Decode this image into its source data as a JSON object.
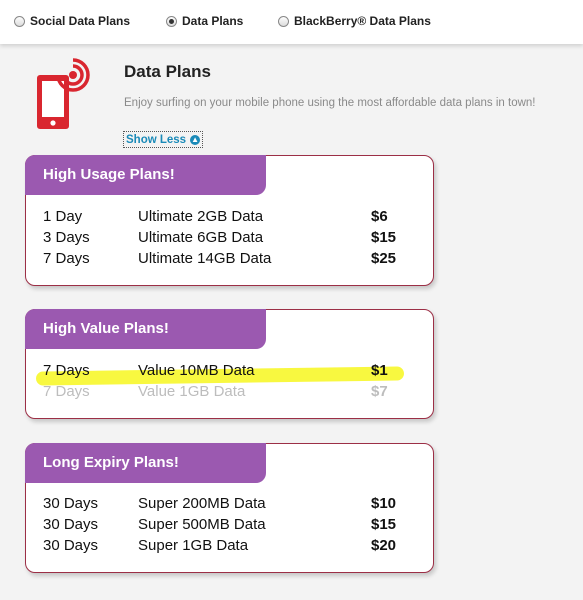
{
  "tabs": [
    {
      "label": "Social Data Plans",
      "checked": false
    },
    {
      "label": "Data Plans",
      "checked": true
    },
    {
      "label": "BlackBerry® Data Plans",
      "checked": false
    }
  ],
  "header": {
    "title": "Data Plans",
    "subtitle": "Enjoy surfing on your mobile phone using the most affordable data plans in town!",
    "show_less": "Show Less"
  },
  "icon_color": "#d9262f",
  "accent_purple": "#9b59b0",
  "cards": [
    {
      "title": "High Usage Plans!",
      "rows": [
        {
          "duration": "1 Day",
          "plan": "Ultimate 2GB Data",
          "price": "$6"
        },
        {
          "duration": "3 Days",
          "plan": "Ultimate 6GB Data",
          "price": "$15"
        },
        {
          "duration": "7 Days",
          "plan": "Ultimate 14GB Data",
          "price": "$25"
        }
      ]
    },
    {
      "title": "High Value Plans!",
      "rows": [
        {
          "duration": "7 Days",
          "plan": "Value 10MB Data",
          "price": "$1"
        },
        {
          "duration": "7 Days",
          "plan": "Value 1GB Data",
          "price": "$7",
          "highlighted": true
        }
      ]
    },
    {
      "title": "Long Expiry Plans!",
      "rows": [
        {
          "duration": "30 Days",
          "plan": "Super 200MB Data",
          "price": "$10"
        },
        {
          "duration": "30 Days",
          "plan": "Super 500MB Data",
          "price": "$15"
        },
        {
          "duration": "30 Days",
          "plan": "Super 1GB Data",
          "price": "$20"
        }
      ]
    }
  ]
}
